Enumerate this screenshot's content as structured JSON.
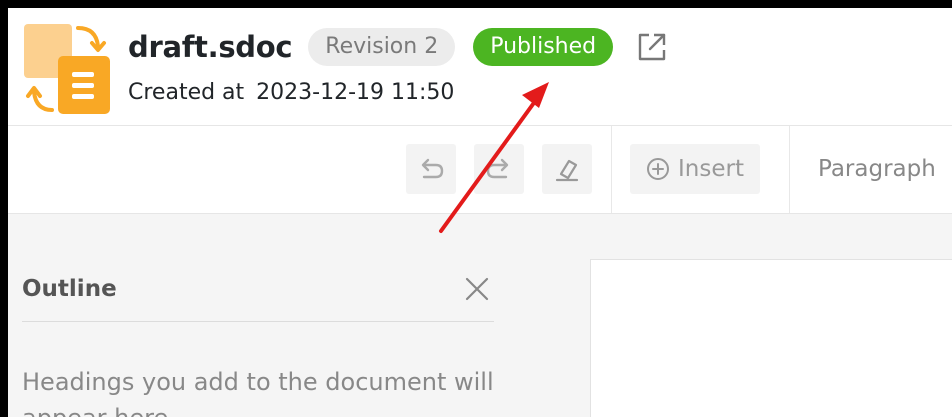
{
  "header": {
    "file_name": "draft.sdoc",
    "revision_label": "Revision 2",
    "status_label": "Published",
    "created_label": "Created at",
    "created_date": "2023-12-19 11:50"
  },
  "toolbar": {
    "insert_label": "Insert",
    "paragraph_label": "Paragraph"
  },
  "outline": {
    "title": "Outline",
    "hint": "Headings you add to the document will appear here"
  },
  "colors": {
    "published_badge": "#4cb522",
    "revision_badge": "#ececec",
    "doc_icon_orange": "#f9a825",
    "doc_icon_light": "#fcd08f",
    "annotation_arrow": "#e31b1b"
  },
  "icons": {
    "doc": "sdoc-revision-icon",
    "external": "external-link-icon",
    "undo": "undo-icon",
    "redo": "redo-icon",
    "clear": "eraser-icon",
    "insert": "plus-circle-icon",
    "close": "close-icon"
  }
}
